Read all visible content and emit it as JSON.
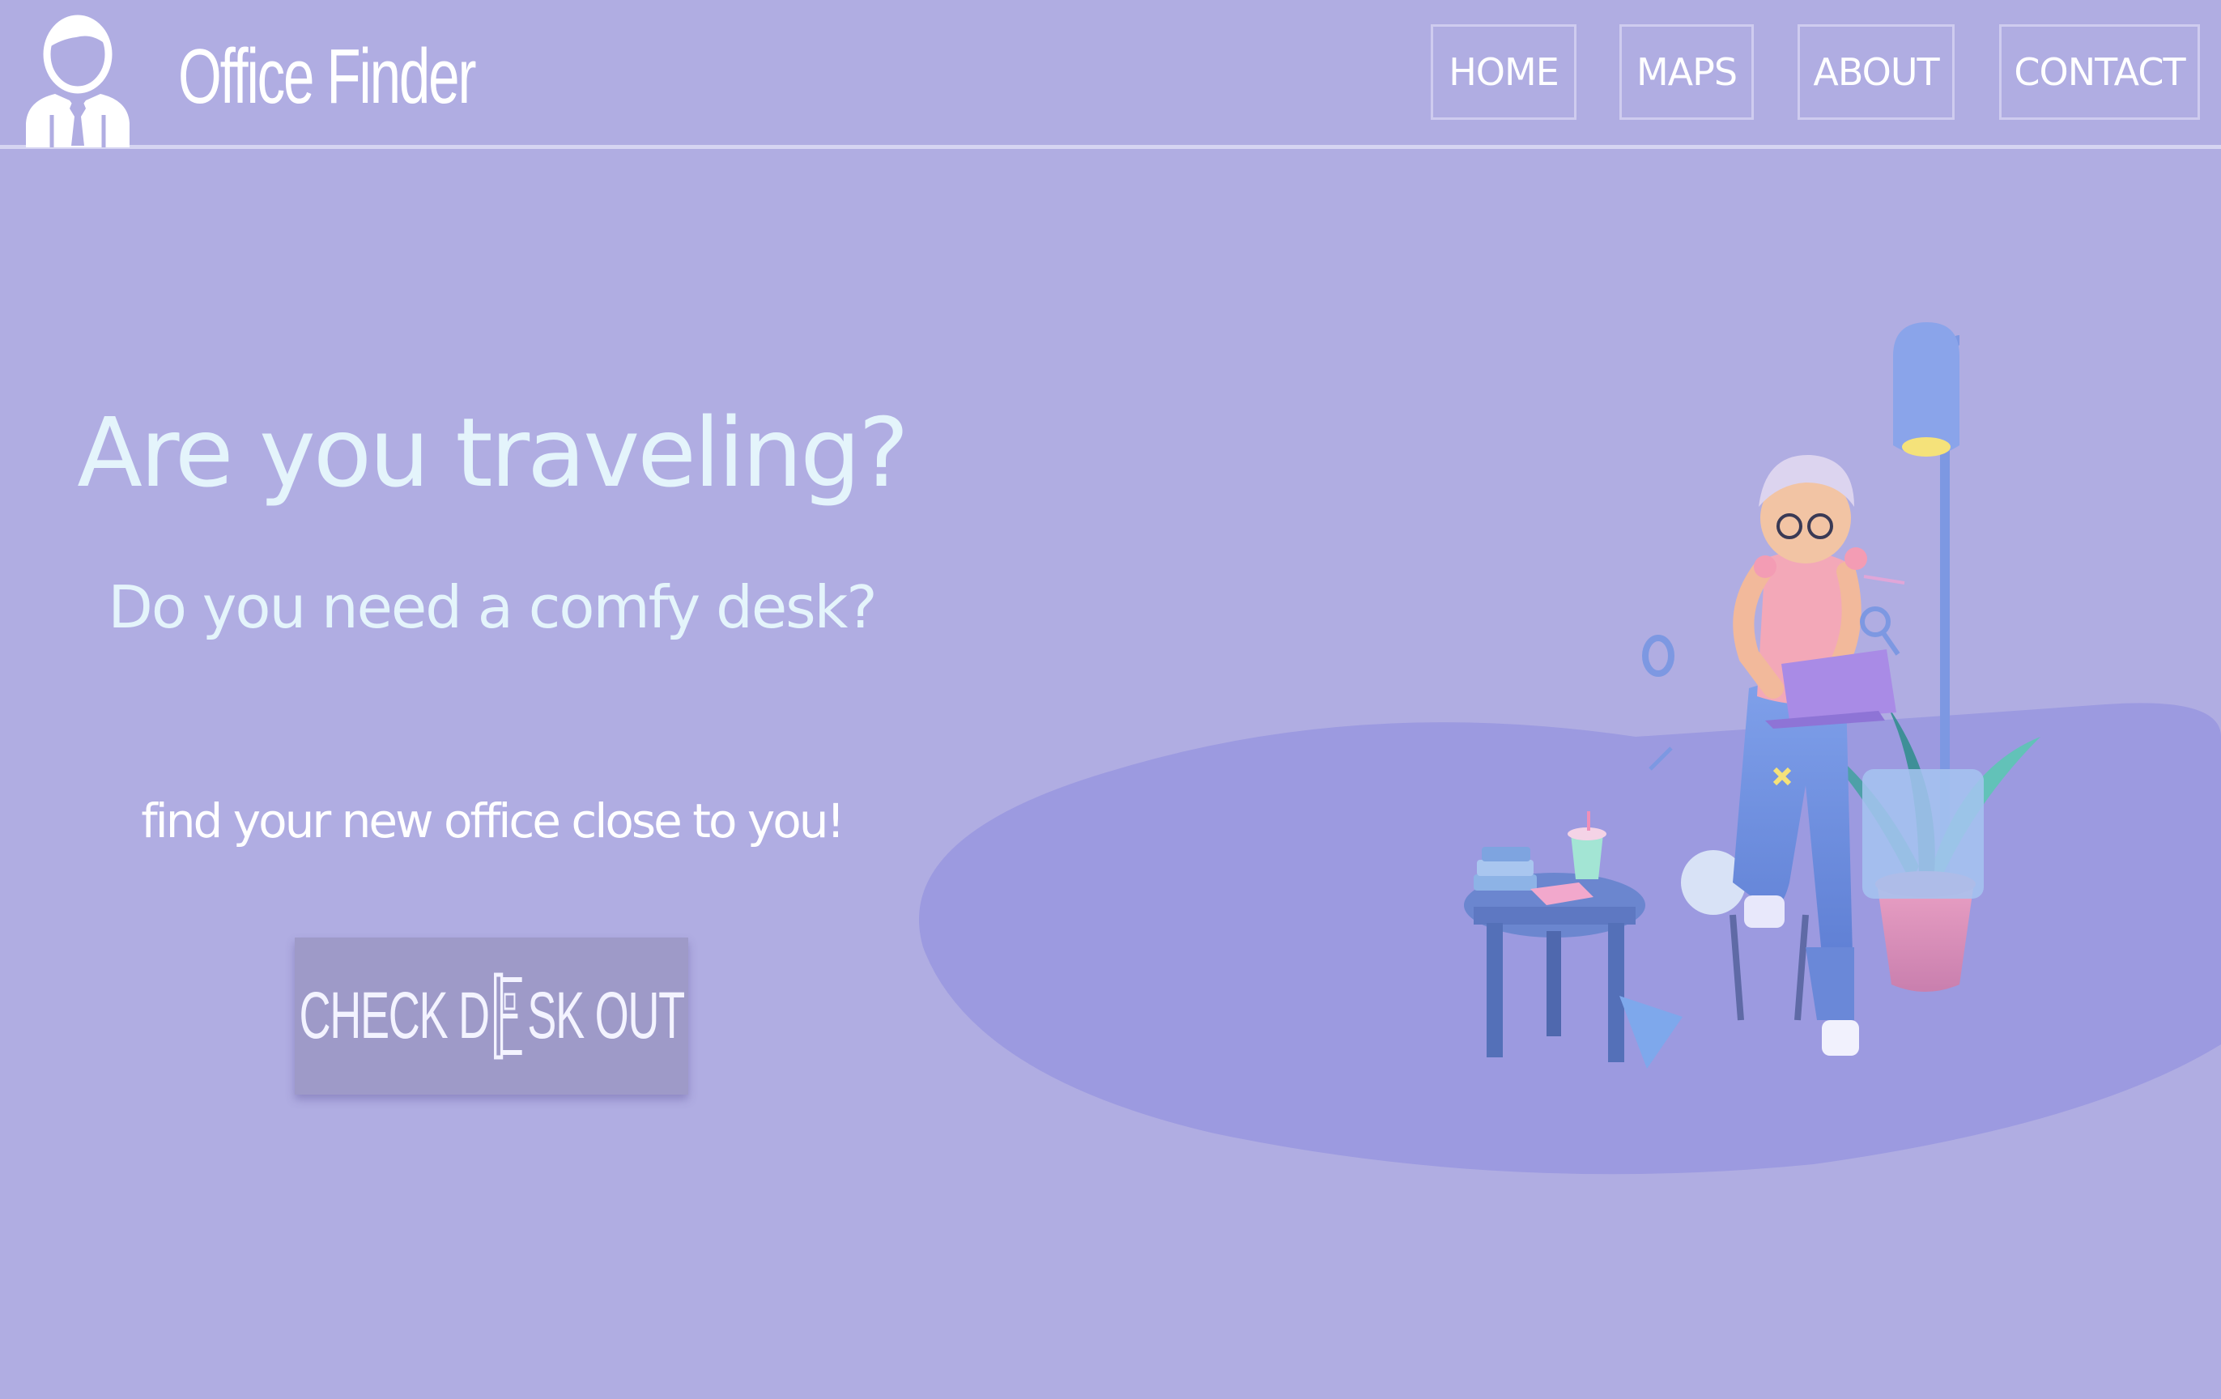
{
  "header": {
    "brand": "Office Finder",
    "logo_icon": "user-tie-icon",
    "nav": [
      {
        "label": "HOME"
      },
      {
        "label": "MAPS"
      },
      {
        "label": "ABOUT"
      },
      {
        "label": "CONTACT"
      }
    ]
  },
  "hero": {
    "title": "Are you traveling?",
    "subtitle": "Do you need a comfy desk?",
    "tagline": "find your new office close to you!",
    "cta": {
      "before": "CHECK D",
      "after": "SK OUT",
      "desk_icon": "desk-letter-e-icon"
    },
    "illustration": "woman-with-laptop-illustration"
  },
  "colors": {
    "background": "#b0ade2",
    "header_line": "#d6d5f2",
    "title_text": "#e4f4fb",
    "cta_bg": "#9e9ac8",
    "floor_shape": "#9c9ae0"
  }
}
